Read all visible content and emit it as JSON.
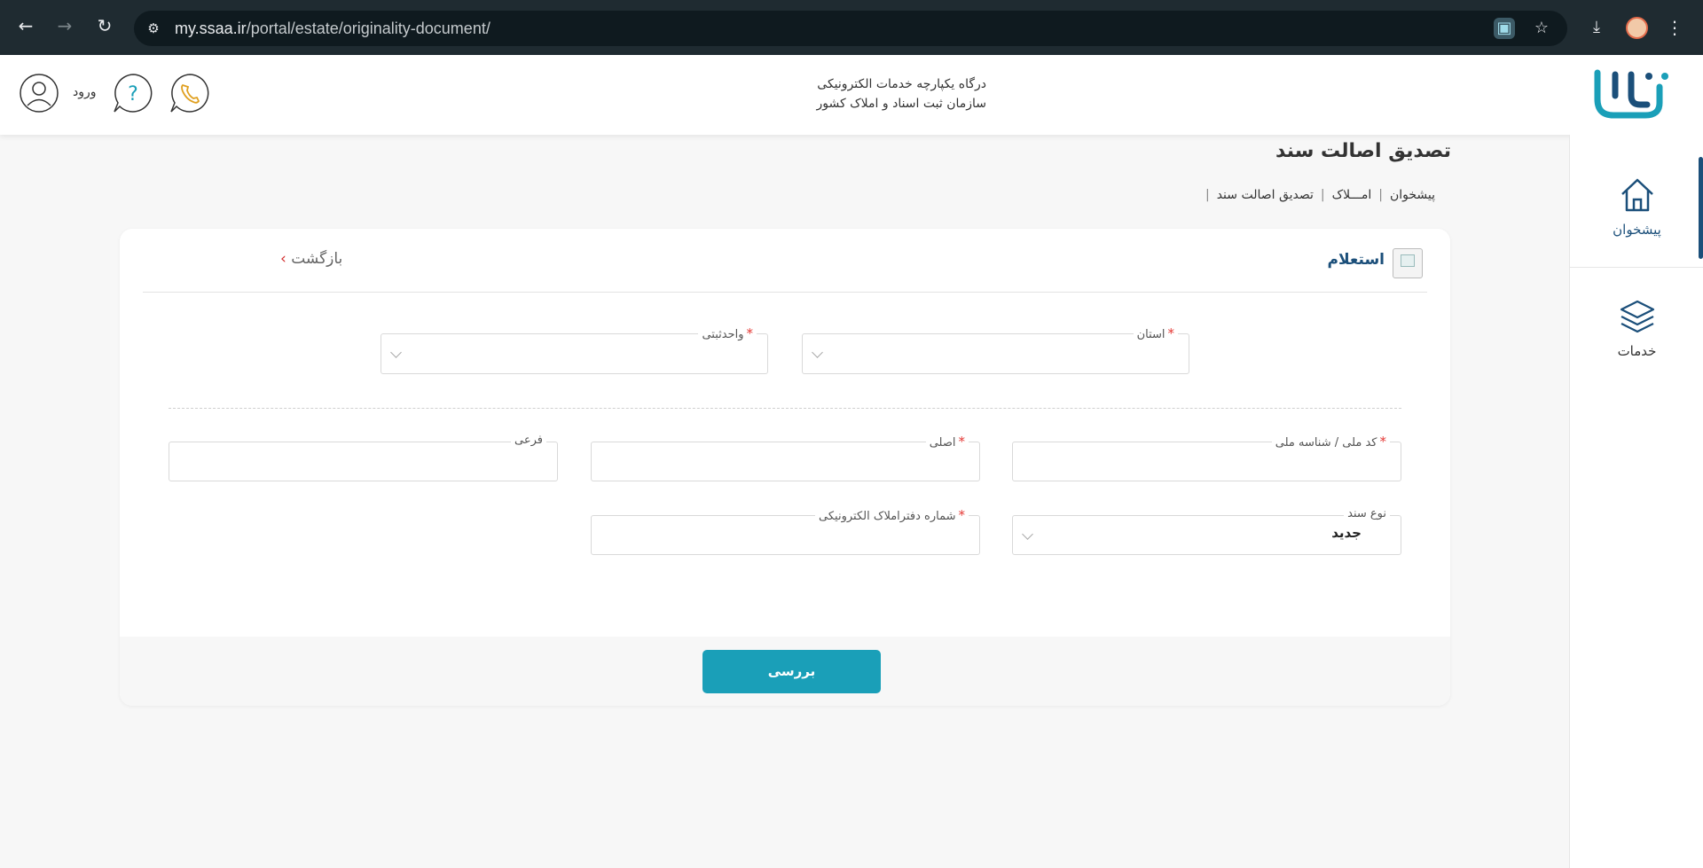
{
  "browser": {
    "url_host": "my.ssaa.ir",
    "url_path": "/portal/estate/originality-document/"
  },
  "header": {
    "portal_line1": "درگاه یکپارچه خدمات الکترونیکی",
    "portal_line2": "سازمان ثبت اسناد و املاک کشور",
    "login_label": "ورود"
  },
  "sidebar": {
    "items": [
      {
        "label": "پیشخوان",
        "icon": "home-icon",
        "active": true
      },
      {
        "label": "خدمات",
        "icon": "layers-icon",
        "active": false
      }
    ]
  },
  "page": {
    "title": "تصدیق اصالت سند",
    "breadcrumb": [
      "پیشخوان",
      "امـــلاک",
      "تصدیق اصالت سند"
    ]
  },
  "card": {
    "title": "استعلام",
    "back_label": "بازگشت",
    "fields": {
      "province": {
        "label": "استان",
        "required": true,
        "value": ""
      },
      "registry_unit": {
        "label": "واحدثبتی",
        "required": true,
        "value": ""
      },
      "national_code": {
        "label": "کد ملی / شناسه ملی",
        "required": true,
        "value": ""
      },
      "main_plate": {
        "label": "اصلی",
        "required": true,
        "value": ""
      },
      "sub_plate": {
        "label": "فرعی",
        "required": false,
        "value": ""
      },
      "document_type": {
        "label": "نوع سند",
        "required": false,
        "value": "جدید"
      },
      "ebook_number": {
        "label": "شماره دفتراملاک الکترونیکی",
        "required": true,
        "value": ""
      }
    },
    "submit_label": "بررسی"
  },
  "colors": {
    "brand_primary": "#1b4f7a",
    "button": "#1a9fb8",
    "required": "#e53935"
  }
}
